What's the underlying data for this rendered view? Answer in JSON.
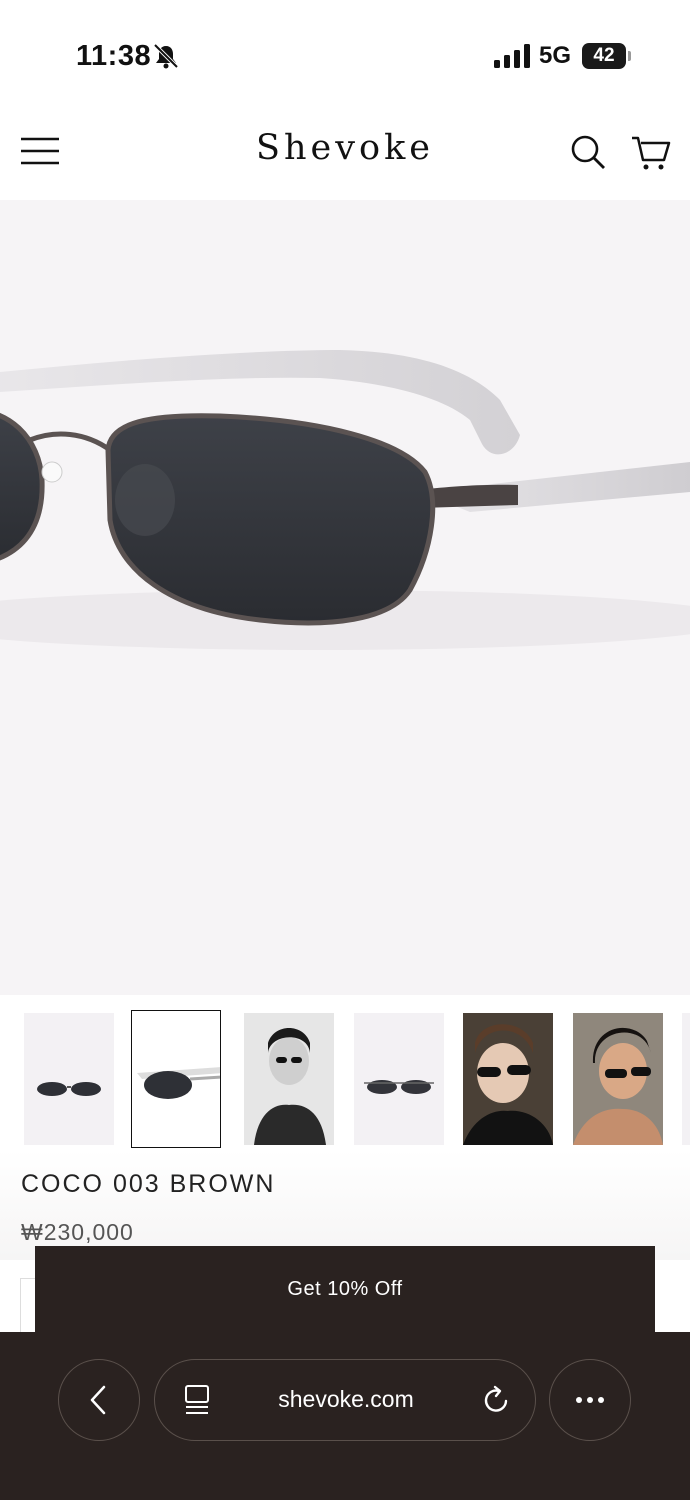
{
  "status_bar": {
    "time": "11:38",
    "network": "5G",
    "battery": "42"
  },
  "header": {
    "logo": "Shevoke"
  },
  "product": {
    "title": "COCO 003 BROWN",
    "price": "₩230,000"
  },
  "thumbnails": [
    "sunglasses-front",
    "sunglasses-side",
    "model-bw",
    "sunglasses-front-2",
    "model-color-1",
    "model-color-2"
  ],
  "promo": {
    "label": "Get 10% Off"
  },
  "browser": {
    "url": "shevoke.com"
  },
  "colors": {
    "hero_bg": "#f6f4f6",
    "bar_bg": "#2a2220",
    "text": "#111111"
  }
}
